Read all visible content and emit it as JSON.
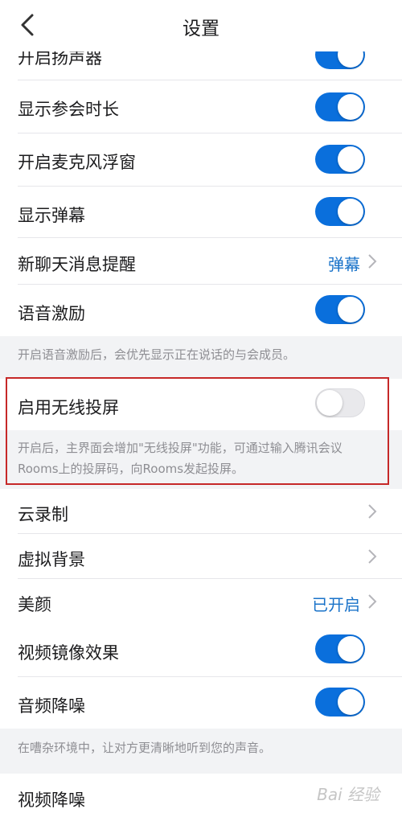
{
  "nav": {
    "title": "设置"
  },
  "settings": {
    "speaker": {
      "label": "开启扬声器"
    },
    "duration": {
      "label": "显示参会时长"
    },
    "mic_float": {
      "label": "开启麦克风浮窗"
    },
    "barrage": {
      "label": "显示弹幕"
    },
    "chat_alert": {
      "label": "新聊天消息提醒",
      "value": "弹幕"
    },
    "voice_stim": {
      "label": "语音激励",
      "note": "开启语音激励后，会优先显示正在说话的与会成员。"
    },
    "wireless": {
      "label": "启用无线投屏",
      "note_line1": "开启后，主界面会增加\"无线投屏\"功能，可通过输入腾讯会议",
      "note_line2": "Rooms上的投屏码，向Rooms发起投屏。"
    },
    "cloud_rec": {
      "label": "云录制"
    },
    "virtual_bg": {
      "label": "虚拟背景"
    },
    "beauty": {
      "label": "美颜",
      "value": "已开启"
    },
    "mirror": {
      "label": "视频镜像效果"
    },
    "audio_nr": {
      "label": "音频降噪",
      "note": "在嘈杂环境中，让对方更清晰地听到您的声音。"
    },
    "video_nr": {
      "label": "视频降噪"
    }
  },
  "toggles": {
    "speaker": true,
    "duration": true,
    "mic_float": true,
    "barrage": true,
    "voice_stim": true,
    "wireless": false,
    "mirror": true,
    "audio_nr": true
  },
  "colors": {
    "accent": "#0a6fdc",
    "link": "#1a73c9",
    "highlight_border": "#c62828"
  },
  "watermark": "Bai 经验"
}
